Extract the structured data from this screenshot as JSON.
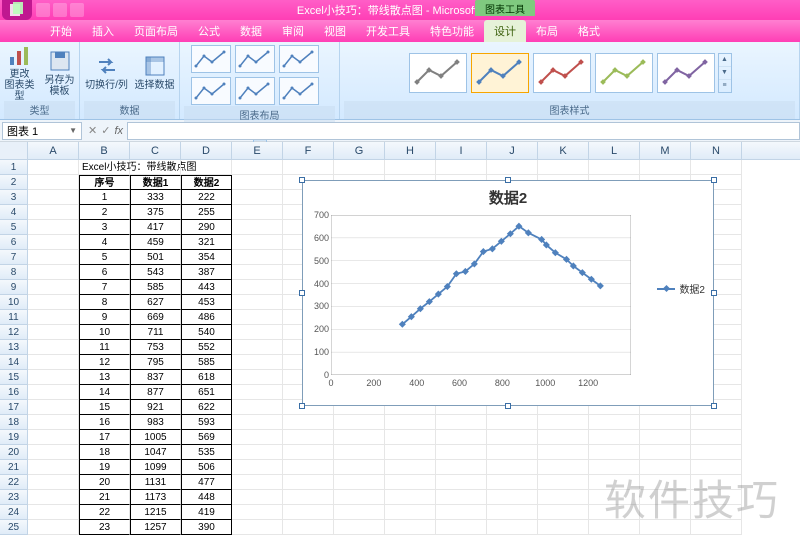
{
  "titlebar": {
    "caption": "Excel小技巧：带线散点图 - Microsoft Excel",
    "context_tool": "图表工具"
  },
  "tabs": {
    "items": [
      "开始",
      "插入",
      "页面布局",
      "公式",
      "数据",
      "审阅",
      "视图",
      "开发工具",
      "特色功能",
      "设计",
      "布局",
      "格式"
    ],
    "active": 9
  },
  "ribbon": {
    "type_group": {
      "label": "类型",
      "change": "更改\n图表类型",
      "saveas": "另存为\n模板"
    },
    "data_group": {
      "label": "数据",
      "switch": "切换行/列",
      "select": "选择数据"
    },
    "layout_group": {
      "label": "图表布局"
    },
    "style_group": {
      "label": "图表样式"
    }
  },
  "style_colors": [
    "#808080",
    "#4f81bd",
    "#c0504d",
    "#9bbb59",
    "#8064a2"
  ],
  "namebox": "图表 1",
  "sheet": {
    "title_cell": "Excel小技巧：带线散点图",
    "headers": [
      "序号",
      "数据1",
      "数据2"
    ],
    "rows": [
      [
        1,
        333,
        222
      ],
      [
        2,
        375,
        255
      ],
      [
        3,
        417,
        290
      ],
      [
        4,
        459,
        321
      ],
      [
        5,
        501,
        354
      ],
      [
        6,
        543,
        387
      ],
      [
        7,
        585,
        443
      ],
      [
        8,
        627,
        453
      ],
      [
        9,
        669,
        486
      ],
      [
        10,
        711,
        540
      ],
      [
        11,
        753,
        552
      ],
      [
        12,
        795,
        585
      ],
      [
        13,
        837,
        618
      ],
      [
        14,
        877,
        651
      ],
      [
        15,
        921,
        622
      ],
      [
        16,
        983,
        593
      ],
      [
        17,
        1005,
        569
      ],
      [
        18,
        1047,
        535
      ],
      [
        19,
        1099,
        506
      ],
      [
        20,
        1131,
        477
      ],
      [
        21,
        1173,
        448
      ],
      [
        22,
        1215,
        419
      ],
      [
        23,
        1257,
        390
      ]
    ],
    "cols": [
      "A",
      "B",
      "C",
      "D",
      "E",
      "F",
      "G",
      "H",
      "I",
      "J",
      "K",
      "L",
      "M",
      "N"
    ]
  },
  "chart_data": {
    "type": "line",
    "title": "数据2",
    "xlabel": "",
    "ylabel": "",
    "xlim": [
      0,
      1400
    ],
    "ylim": [
      0,
      700
    ],
    "xticks": [
      0,
      200,
      400,
      600,
      800,
      1000,
      1200
    ],
    "yticks": [
      0,
      100,
      200,
      300,
      400,
      500,
      600,
      700
    ],
    "series": [
      {
        "name": "数据2",
        "x": [
          333,
          375,
          417,
          459,
          501,
          543,
          585,
          627,
          669,
          711,
          753,
          795,
          837,
          877,
          921,
          983,
          1005,
          1047,
          1099,
          1131,
          1173,
          1215,
          1257
        ],
        "y": [
          222,
          255,
          290,
          321,
          354,
          387,
          443,
          453,
          486,
          540,
          552,
          585,
          618,
          651,
          622,
          593,
          569,
          535,
          506,
          477,
          448,
          419,
          390
        ]
      }
    ],
    "legend_position": "right",
    "color": "#4f81bd"
  },
  "watermark": "软件技巧"
}
